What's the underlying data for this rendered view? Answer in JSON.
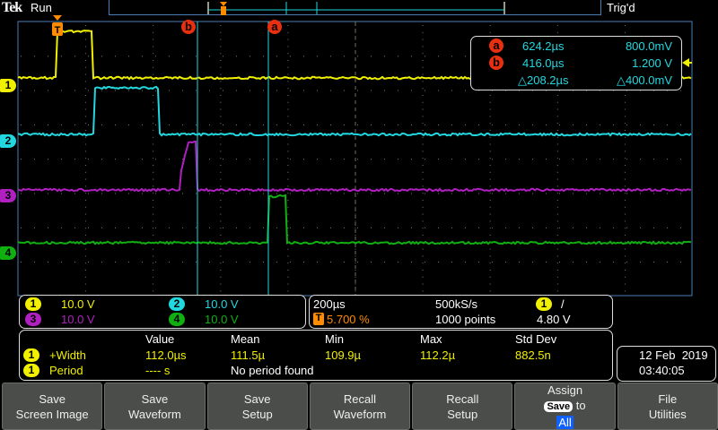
{
  "header": {
    "brand": "Tek",
    "run_state": "Run",
    "trigger_status": "Trig'd"
  },
  "channels": [
    {
      "id": "1",
      "scale": "10.0 V",
      "color": "#f0f000"
    },
    {
      "id": "2",
      "scale": "10.0 V",
      "color": "#22d8e0"
    },
    {
      "id": "3",
      "scale": "10.0 V",
      "color": "#b020c0"
    },
    {
      "id": "4",
      "scale": "10.0 V",
      "color": "#10b010"
    }
  ],
  "cursors": {
    "a": {
      "label": "a",
      "time": "624.2µs",
      "voltage": "800.0mV"
    },
    "b": {
      "label": "b",
      "time": "416.0µs",
      "voltage": "1.200 V"
    },
    "delta": {
      "time": "△208.2µs",
      "voltage": "△400.0mV"
    }
  },
  "horizontal": {
    "timebase": "200µs",
    "sample_rate": "500kS/s",
    "trigger_marker": "T",
    "trigger_position": "5.700 %",
    "record_length": "1000 points",
    "trigger_source": "1",
    "trigger_slope": "/",
    "trigger_level": "4.80 V"
  },
  "measurements": {
    "headers": [
      "Value",
      "Mean",
      "Min",
      "Max",
      "Std Dev"
    ],
    "rows": [
      {
        "source": "1",
        "name": "+Width",
        "value": "112.0µs",
        "mean": "111.5µ",
        "min": "109.9µ",
        "max": "112.2µ",
        "std": "882.5n"
      },
      {
        "source": "1",
        "name": "Period",
        "value": "---- s",
        "message": "No period found"
      }
    ]
  },
  "datetime": {
    "date": "12 Feb  2019",
    "time": "03:40:05"
  },
  "softkeys": [
    {
      "l1": "Save",
      "l2": "Screen Image"
    },
    {
      "l1": "Save",
      "l2": "Waveform"
    },
    {
      "l1": "Save",
      "l2": "Setup"
    },
    {
      "l1": "Recall",
      "l2": "Waveform"
    },
    {
      "l1": "Recall",
      "l2": "Setup"
    },
    {
      "l1": "Assign",
      "badge": "Save",
      "l2": "to",
      "l3": "All"
    },
    {
      "l1": "File",
      "l2": "Utilities"
    }
  ]
}
